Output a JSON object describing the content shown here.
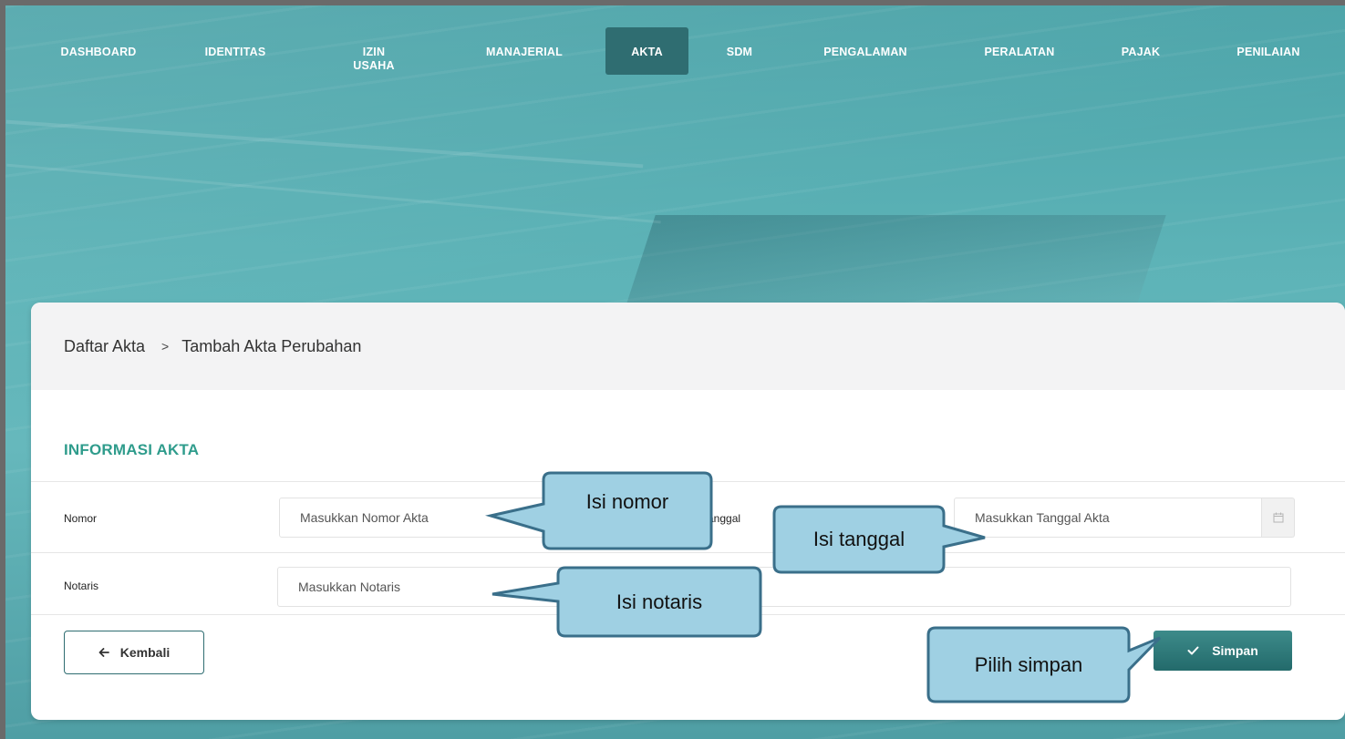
{
  "nav": {
    "items": [
      {
        "label": "DASHBOARD",
        "active": false
      },
      {
        "label": "IDENTITAS",
        "active": false
      },
      {
        "label": "IZIN USAHA",
        "active": false
      },
      {
        "label": "MANAJERIAL",
        "active": false
      },
      {
        "label": "AKTA",
        "active": true
      },
      {
        "label": "SDM",
        "active": false
      },
      {
        "label": "PENGALAMAN",
        "active": false
      },
      {
        "label": "PERALATAN",
        "active": false
      },
      {
        "label": "PAJAK",
        "active": false
      },
      {
        "label": "PENILAIAN",
        "active": false
      }
    ]
  },
  "breadcrumb": {
    "parent": "Daftar Akta",
    "separator": ">",
    "current": "Tambah Akta Perubahan"
  },
  "form": {
    "section_title": "INFORMASI AKTA",
    "nomor_label": "Nomor",
    "nomor_placeholder": "Masukkan Nomor Akta",
    "tanggal_label": "Tanggal",
    "tanggal_placeholder": "Masukkan Tanggal Akta",
    "notaris_label": "Notaris",
    "notaris_placeholder": "Masukkan Notaris"
  },
  "actions": {
    "back_label": "Kembali",
    "save_label": "Simpan"
  },
  "callouts": {
    "nomor": "Isi nomor",
    "tanggal": "Isi tanggal",
    "notaris": "Isi notaris",
    "simpan": "Pilih simpan"
  },
  "colors": {
    "accent": "#2f6d71",
    "section_title": "#2f9c8c",
    "callout_fill": "#9fd0e3",
    "callout_border": "#3a6f8a"
  }
}
